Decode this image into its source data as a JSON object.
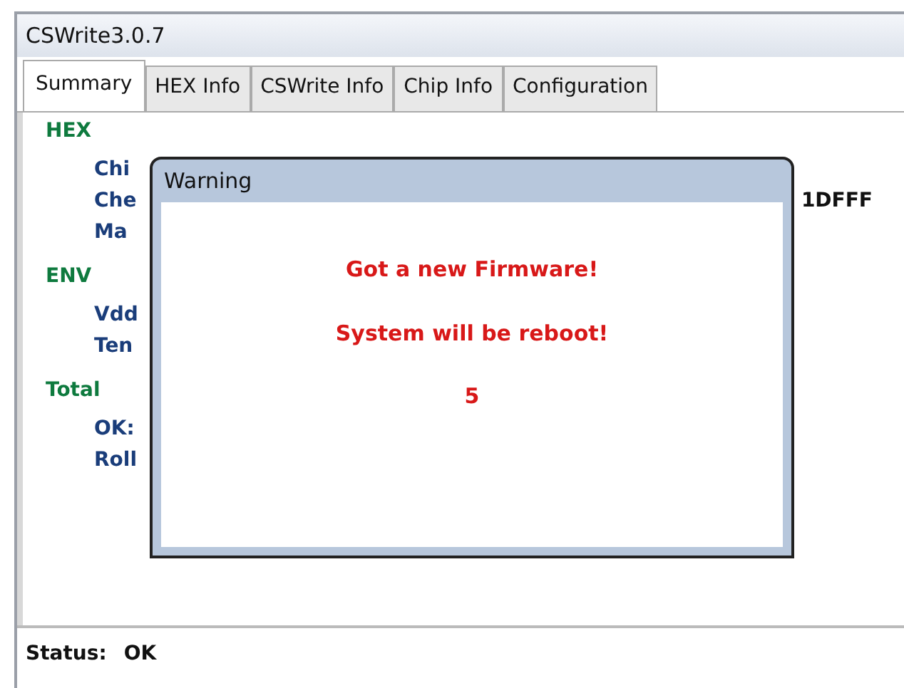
{
  "window": {
    "title": "CSWrite3.0.7"
  },
  "tabs": [
    {
      "label": "Summary",
      "selected": true
    },
    {
      "label": "HEX Info",
      "selected": false
    },
    {
      "label": "CSWrite Info",
      "selected": false
    },
    {
      "label": "Chip Info",
      "selected": false
    },
    {
      "label": "Configuration",
      "selected": false
    }
  ],
  "summary": [
    {
      "heading": "HEX",
      "rows": [
        {
          "label": "Chi"
        },
        {
          "label": "Che",
          "value": "1DFFF"
        },
        {
          "label": "Ma"
        }
      ]
    },
    {
      "heading": "ENV",
      "rows": [
        {
          "label": "Vdd"
        },
        {
          "label": "Ten"
        }
      ]
    },
    {
      "heading": "Total",
      "rows": [
        {
          "label": "OK:"
        },
        {
          "label": "Roll"
        }
      ]
    }
  ],
  "dialog": {
    "title": "Warning",
    "lines": [
      "Got a new Firmware!",
      "System will be reboot!",
      "5"
    ]
  },
  "status_bar": {
    "label": "Status:",
    "value": "OK"
  }
}
